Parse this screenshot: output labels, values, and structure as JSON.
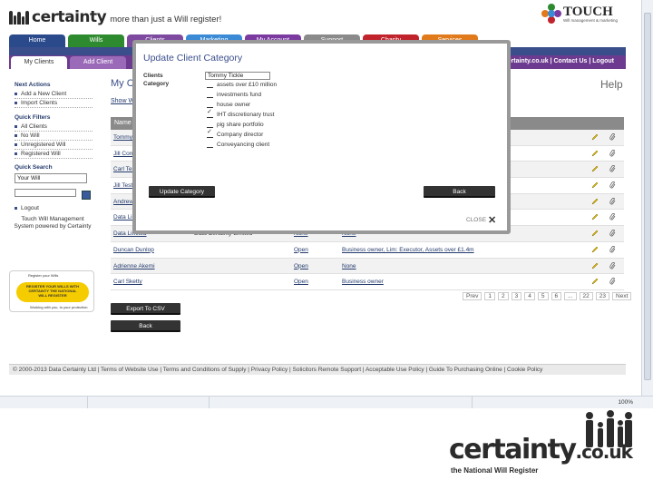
{
  "header": {
    "logo": "certainty",
    "tagline": "more than just a Will register!",
    "touch": "TOUCH",
    "touch_sub": "Will management & marketing"
  },
  "nav": {
    "tabs": [
      {
        "label": "Home",
        "color": "#2a4a8c"
      },
      {
        "label": "Wills",
        "color": "#2e8a2e"
      },
      {
        "label": "Clients",
        "color": "#7d4aa0"
      },
      {
        "label": "Marketing",
        "color": "#3a8ad6"
      },
      {
        "label": "My Account",
        "color": "#7a3aa0"
      },
      {
        "label": "Support",
        "color": "#8a8a8a"
      },
      {
        "label": "Charity",
        "color": "#c0232b"
      },
      {
        "label": "Services",
        "color": "#e07a1a"
      }
    ]
  },
  "subnav": {
    "items": [
      "My Clients",
      "Add Client"
    ],
    "right": "certainty.co.uk | Contact Us | Logout"
  },
  "sidebar": {
    "next_actions_heading": "Next Actions",
    "next_actions": [
      "Add a New Client",
      "Import Clients"
    ],
    "quick_filters_heading": "Quick Filters",
    "quick_filters": [
      "All Clients",
      "No Will",
      "Unregistered Will",
      "Registered Will"
    ],
    "quick_search_heading": "Quick Search",
    "search_select": "Your Will",
    "logout": "Logout",
    "powered": "Touch Will Management System powered by Certainty",
    "badge_top": "Register your Wills",
    "badge_text": "REGISTER YOUR WILLS WITH CERTAINTY THE NATIONAL WILL REGISTER",
    "badge_bottom": "Working with you, to your protection"
  },
  "main": {
    "title": "My Clients",
    "help": "Help",
    "show_link": "Show Wills",
    "header_col": "Name",
    "rows": [
      {
        "name": "Tommy Tickle",
        "company": "",
        "will": "",
        "category": ""
      },
      {
        "name": "Jill Corn",
        "company": "",
        "will": "",
        "category": ""
      },
      {
        "name": "Carl Test",
        "company": "",
        "will": "",
        "category": ""
      },
      {
        "name": "Jill Test",
        "company": "",
        "will": "",
        "category": ""
      },
      {
        "name": "Andrew",
        "company": "",
        "will": "",
        "category": ""
      },
      {
        "name": "Data Limited",
        "company": "",
        "will": "",
        "category": ""
      },
      {
        "name": "Data Limited",
        "company": "Data Certainty Limited",
        "will": "None",
        "category": "None"
      },
      {
        "name": "Duncan Dunlop",
        "company": "",
        "will": "Open",
        "category": "Business owner, Lim: Executor, Assets over £1.4m",
        "category_link": true
      },
      {
        "name": "Adrienne Akemi",
        "company": "",
        "will": "Open",
        "category": "None",
        "category_link": true
      },
      {
        "name": "Carl Sketty",
        "company": "",
        "will": "Open",
        "category": "Business owner",
        "category_link": true
      }
    ],
    "pager": [
      "Prev",
      "1",
      "2",
      "3",
      "4",
      "5",
      "6",
      "...",
      "22",
      "23",
      "Next"
    ],
    "export_btn": "Export To CSV",
    "back_btn": "Back"
  },
  "footer": {
    "text": "© 2000-2013 Data Certainty Ltd | Terms of Website Use | Terms and Conditions of Supply | Privacy Policy | Solicitors Remote Support | Acceptable Use Policy | Guide To Purchasing Online | Cookie Policy"
  },
  "modal": {
    "title": "Update Client Category",
    "clients_label": "Clients",
    "category_label": "Category",
    "client_value": "Tommy Tickle",
    "categories": [
      {
        "label": "assets over £10 million",
        "checked": false
      },
      {
        "label": "investments fund",
        "checked": false
      },
      {
        "label": "house owner",
        "checked": false
      },
      {
        "label": "IHT discretionary trust",
        "checked": true
      },
      {
        "label": "pig share portfolio",
        "checked": false
      },
      {
        "label": "Company director",
        "checked": true
      },
      {
        "label": "Conveyancing client",
        "checked": false
      }
    ],
    "update_btn": "Update Category",
    "back_btn": "Back",
    "close": "CLOSE"
  },
  "status": {
    "zoom": "100%"
  },
  "branding": {
    "word": "certainty",
    "suffix": ".co.uk",
    "sub": "the National Will Register"
  }
}
